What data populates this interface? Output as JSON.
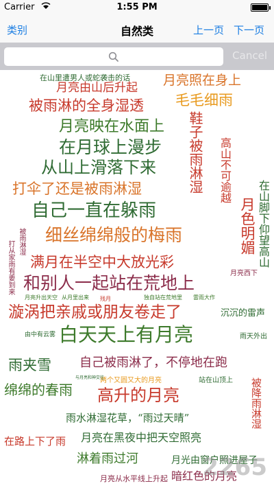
{
  "status_bar": {
    "carrier": "Carrier",
    "time": "1:55 PM"
  },
  "nav": {
    "left": "类别",
    "title": "自然类",
    "prev": "上一页",
    "next": "下一页"
  },
  "search": {
    "placeholder": "",
    "cancel": "Cancel"
  },
  "words": [
    "在山里遭男人或蛇袭击的话",
    "月亮由山后升起",
    "月亮照在身上",
    "被雨淋的全身湿透",
    "毛毛细雨",
    "月亮映在水面上",
    "在月球上漫步",
    "高山不可逾越",
    "鞋子被雨淋湿",
    "从山上滑落下来",
    "在山脚下仰望高山",
    "打伞了还是被雨淋湿",
    "月色明媚",
    "自己一直在躲雨",
    "被雨淋湿",
    "打从家雨有要到来",
    "细丝绵绵般的梅雨",
    "满月在半空中大放光彩",
    "月亮西下",
    "和别人一起站在荒地上",
    "月亮升出天空",
    "残月",
    "从月里出来",
    "独自站在荒地里",
    "雷雨大作",
    "漩涡把亲戚或朋友卷走了",
    "沉沉的雷声",
    "由中有云雾",
    "白天天上有月亮",
    "雨天外出",
    "雨夹雪",
    "自己被雨淋了，不停地在跑",
    "绵绵的春雨",
    "两个又圆又大的月亮",
    "站在山顶上",
    "被降雨淋湿",
    "高升的月亮",
    "雨水淋湿花草，“雨过天晴”",
    "在路上下了雨",
    "月亮在黑夜中把天空照亮",
    "淋着雨过河",
    "月光由窗户照进屋子",
    "暗红色的月亮",
    "月亮从水平线上升起",
    "与月亮和神交往"
  ],
  "watermark": "2265"
}
